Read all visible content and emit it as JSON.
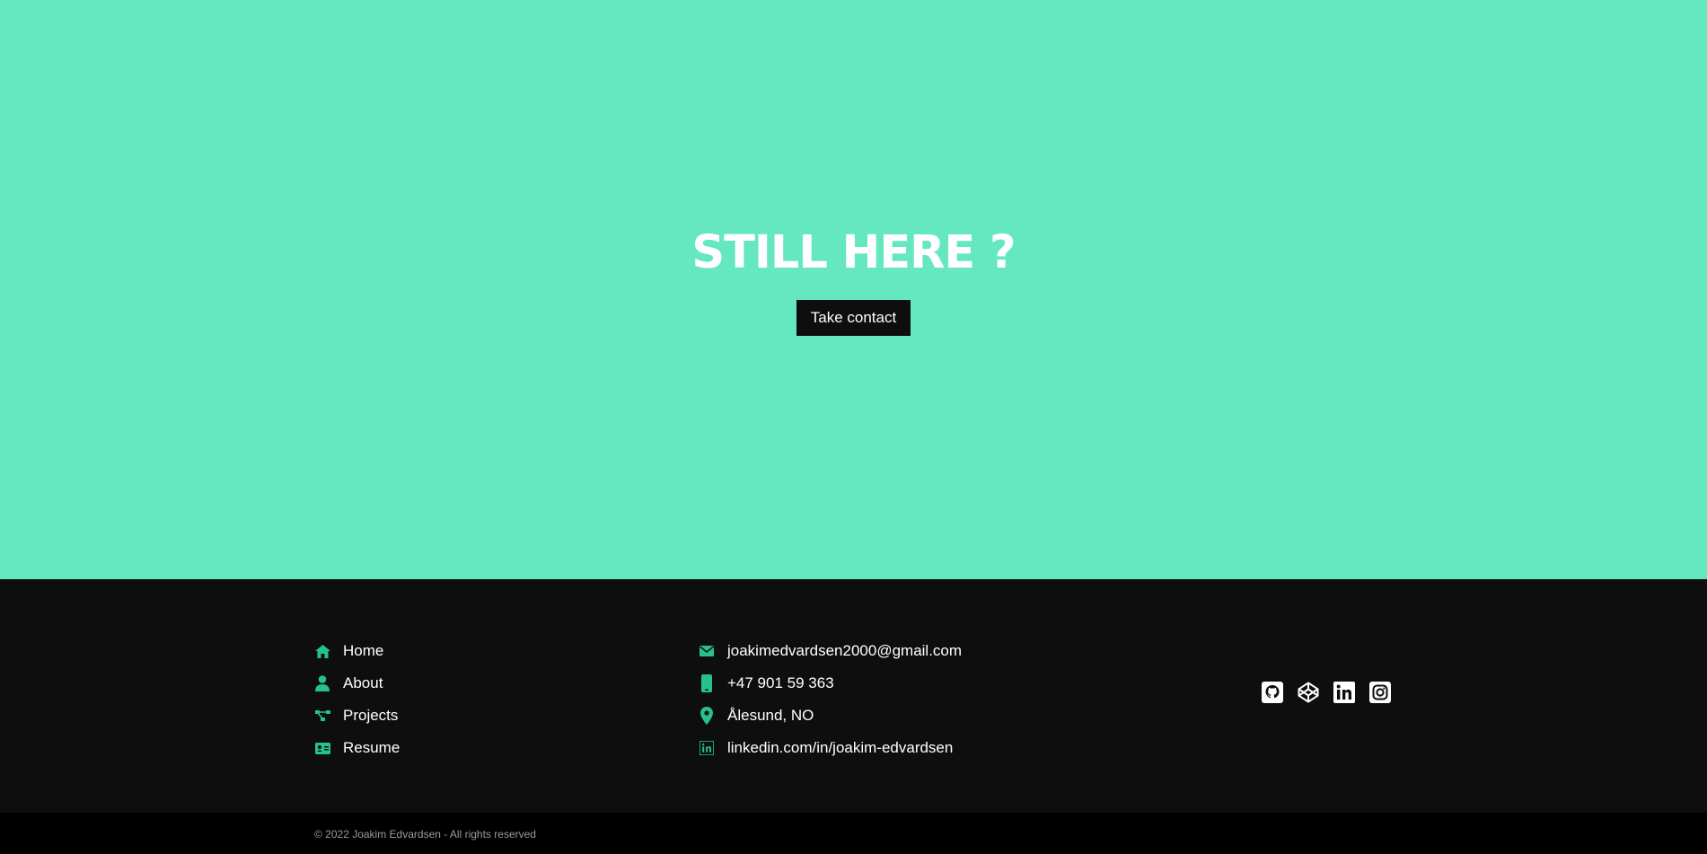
{
  "hero": {
    "title": "STILL HERE ?",
    "cta_label": "Take contact",
    "background": "#65e8c0"
  },
  "nav": {
    "items": [
      {
        "label": "Home",
        "icon": "home-icon"
      },
      {
        "label": "About",
        "icon": "user-icon"
      },
      {
        "label": "Projects",
        "icon": "project-diagram-icon"
      },
      {
        "label": "Resume",
        "icon": "id-card-icon"
      }
    ]
  },
  "contact": {
    "items": [
      {
        "label": "joakimedvardsen2000@gmail.com",
        "icon": "envelope-icon"
      },
      {
        "label": "+47 901 59 363",
        "icon": "mobile-icon"
      },
      {
        "label": "Ålesund, NO",
        "icon": "map-marker-icon"
      },
      {
        "label": "linkedin.com/in/joakim-edvardsen",
        "icon": "linkedin-icon"
      }
    ]
  },
  "socials": [
    {
      "icon": "github-icon"
    },
    {
      "icon": "codepen-icon"
    },
    {
      "icon": "linkedin-icon"
    },
    {
      "icon": "instagram-icon"
    }
  ],
  "footer": {
    "copyright": "© 2022 Joakim Edvardsen - All rights reserved"
  },
  "colors": {
    "accent": "#25c18f",
    "dark": "#0e0e0e",
    "bottom_bar": "#000000"
  }
}
